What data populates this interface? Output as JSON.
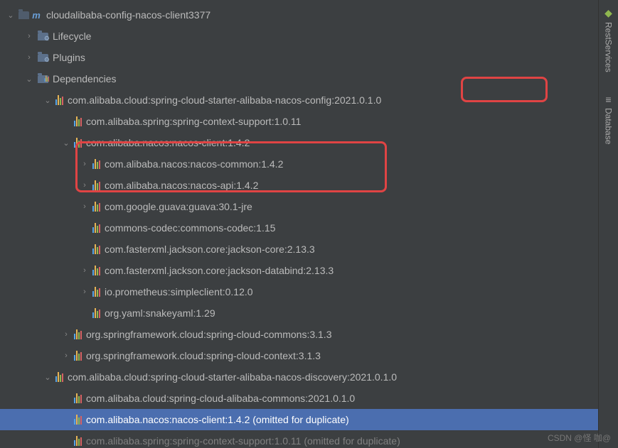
{
  "sideTabs": {
    "rest": "RestServices",
    "db": "Database"
  },
  "watermark": "CSDN @怪 咖@",
  "tree": [
    {
      "indent": 0,
      "arrow": "down",
      "iconType": "maven",
      "label": "cloudalibaba-config-nacos-client3377"
    },
    {
      "indent": 1,
      "arrow": "right",
      "iconType": "folder-gear",
      "label": "Lifecycle"
    },
    {
      "indent": 1,
      "arrow": "right",
      "iconType": "folder-gear",
      "label": "Plugins"
    },
    {
      "indent": 1,
      "arrow": "down",
      "iconType": "folder-bars",
      "label": "Dependencies"
    },
    {
      "indent": 2,
      "arrow": "down",
      "iconType": "bars",
      "label": "com.alibaba.cloud:spring-cloud-starter-alibaba-nacos-config:2021.0.1.0"
    },
    {
      "indent": 3,
      "arrow": "none",
      "iconType": "bars",
      "label": "com.alibaba.spring:spring-context-support:1.0.11"
    },
    {
      "indent": 3,
      "arrow": "down",
      "iconType": "bars",
      "label": "com.alibaba.nacos:nacos-client:1.4.2"
    },
    {
      "indent": 4,
      "arrow": "right",
      "iconType": "bars",
      "label": "com.alibaba.nacos:nacos-common:1.4.2"
    },
    {
      "indent": 4,
      "arrow": "right",
      "iconType": "bars",
      "label": "com.alibaba.nacos:nacos-api:1.4.2"
    },
    {
      "indent": 4,
      "arrow": "right",
      "iconType": "bars",
      "label": "com.google.guava:guava:30.1-jre"
    },
    {
      "indent": 4,
      "arrow": "none",
      "iconType": "bars",
      "label": "commons-codec:commons-codec:1.15"
    },
    {
      "indent": 4,
      "arrow": "none",
      "iconType": "bars",
      "label": "com.fasterxml.jackson.core:jackson-core:2.13.3"
    },
    {
      "indent": 4,
      "arrow": "right",
      "iconType": "bars",
      "label": "com.fasterxml.jackson.core:jackson-databind:2.13.3"
    },
    {
      "indent": 4,
      "arrow": "right",
      "iconType": "bars",
      "label": "io.prometheus:simpleclient:0.12.0"
    },
    {
      "indent": 4,
      "arrow": "none",
      "iconType": "bars",
      "label": "org.yaml:snakeyaml:1.29"
    },
    {
      "indent": 3,
      "arrow": "right",
      "iconType": "bars",
      "label": "org.springframework.cloud:spring-cloud-commons:3.1.3"
    },
    {
      "indent": 3,
      "arrow": "right",
      "iconType": "bars",
      "label": "org.springframework.cloud:spring-cloud-context:3.1.3"
    },
    {
      "indent": 2,
      "arrow": "down",
      "iconType": "bars",
      "label": "com.alibaba.cloud:spring-cloud-starter-alibaba-nacos-discovery:2021.0.1.0"
    },
    {
      "indent": 3,
      "arrow": "none",
      "iconType": "bars",
      "label": "com.alibaba.cloud:spring-cloud-alibaba-commons:2021.0.1.0"
    },
    {
      "indent": 3,
      "arrow": "none",
      "iconType": "bars",
      "label": "com.alibaba.nacos:nacos-client:1.4.2 (omitted for duplicate)",
      "selected": true
    },
    {
      "indent": 3,
      "arrow": "none",
      "iconType": "bars",
      "label": "com.alibaba.spring:spring-context-support:1.0.11 (omitted for duplicate)",
      "dimmed": true
    }
  ]
}
